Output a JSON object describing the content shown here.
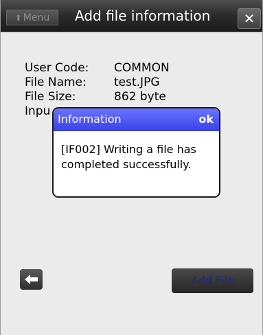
{
  "header": {
    "menu_label": "Menu",
    "menu_icon": "up-arrow-icon",
    "title": "Add file information",
    "close_label": "✕"
  },
  "file_info": {
    "user_code_label": "User Code:",
    "user_code_value": "COMMON",
    "file_name_label": "File Name:",
    "file_name_value": "test.JPG",
    "file_size_label": "File Size:",
    "file_size_value": "862 byte",
    "input_label_partial": "Inpu"
  },
  "dialog": {
    "title": "Information",
    "ok_label": "ok",
    "message": "[IF002] Writing a file has completed successfully.",
    "header_color": "#3a40e8"
  },
  "footer": {
    "back_icon": "back-arrow-icon",
    "add_file_label": "Add File"
  }
}
